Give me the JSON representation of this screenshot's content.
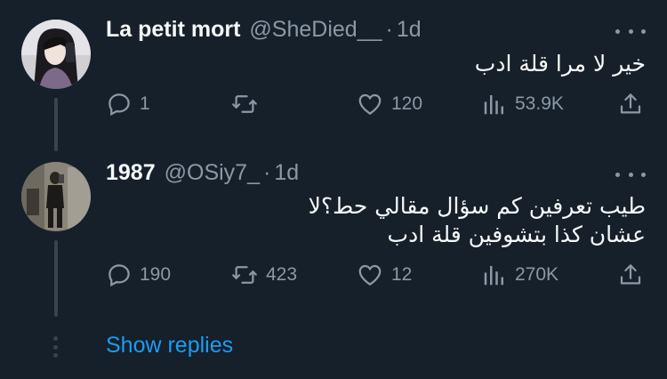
{
  "tweets": [
    {
      "name": "La petit mort",
      "handle": "@SheDied__",
      "separator": "·",
      "time": "1d",
      "text": "خير  لا مرا قلة ادب",
      "replies": "1",
      "retweets": "",
      "likes": "120",
      "views": "53.9K"
    },
    {
      "name": "1987",
      "handle": "@OSiy7_",
      "separator": "·",
      "time": "1d",
      "text_line1": "طيب تعرفين كم سؤال مقالي حط؟لا",
      "text_line2": "عشان كذا بتشوفين قلة ادب",
      "replies": "190",
      "retweets": "423",
      "likes": "12",
      "views": "270K"
    }
  ],
  "show_replies": "Show replies",
  "colors": {
    "background": "#15202b",
    "text": "#f7f9f9",
    "secondary": "#8b98a5",
    "accent": "#1d9bf0",
    "thread_line": "#38444d"
  }
}
